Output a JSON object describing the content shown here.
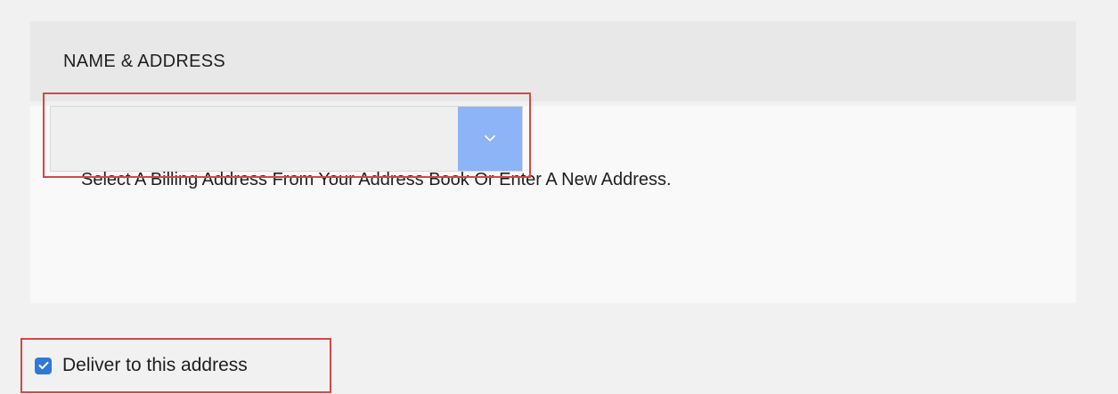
{
  "section": {
    "title": "NAME & ADDRESS"
  },
  "billing": {
    "prompt": "Select A Billing Address From Your Address Book Or Enter A New Address.",
    "select": {
      "selected_value": "",
      "toggle_icon": "chevron-down-icon"
    }
  },
  "delivery": {
    "checkbox_checked": true,
    "checkbox_icon": "checkmark-icon",
    "label": "Deliver to this address"
  },
  "colors": {
    "page_background": "#f1f1f1",
    "header_background": "#e8e8e8",
    "body_background": "#f9f9f9",
    "select_toggle": "#8db4f7",
    "checkbox": "#2f78d6",
    "highlight_border": "#d24848"
  }
}
